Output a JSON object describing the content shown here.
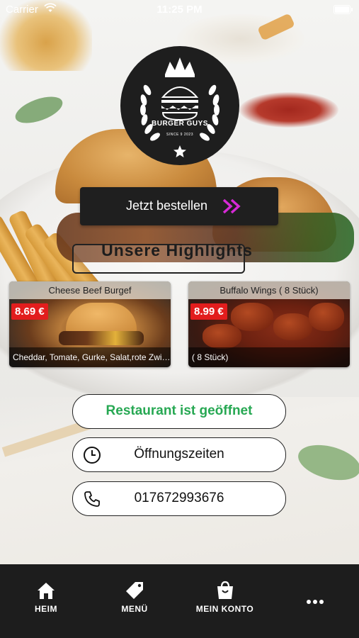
{
  "status_bar": {
    "carrier": "Carrier",
    "time": "11:25 PM"
  },
  "logo": {
    "brand": "BURGER GUYS",
    "since": "SINCE 9 2023"
  },
  "order_button": {
    "label": "Jetzt bestellen",
    "accent": "#d62ad6"
  },
  "highlights": {
    "title": "Unsere Highlights",
    "items": [
      {
        "title": "Cheese Beef Burgef",
        "price": "8.69 €",
        "description": "Cheddar, Tomate, Gurke, Salat,rote Zwie..."
      },
      {
        "title": "Buffalo Wings ( 8 Stück)",
        "price": "8.99 €",
        "description": "( 8 Stück)"
      }
    ]
  },
  "actions": {
    "open_status": "Restaurant ist geöffnet",
    "opening_hours": "Öffnungszeiten",
    "phone": "017672993676",
    "open_color": "#27a853"
  },
  "tab_bar": {
    "items": [
      {
        "label": "HEIM",
        "icon": "home-icon"
      },
      {
        "label": "MENÜ",
        "icon": "tag-icon"
      },
      {
        "label": "MEIN KONTO",
        "icon": "shopping-bag-icon"
      },
      {
        "label": "",
        "icon": "more-icon"
      }
    ]
  },
  "colors": {
    "price_badge": "#e21d1d",
    "tab_bar_bg": "#1d1d1d"
  }
}
